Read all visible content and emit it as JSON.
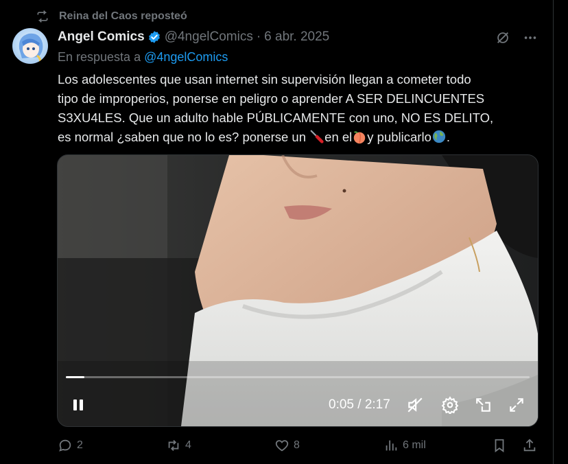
{
  "repost": {
    "text": "Reina del Caos reposteó",
    "icon": "repost-icon"
  },
  "author": {
    "name": "Angel Comics",
    "handle": "@4ngelComics",
    "separator": "·",
    "date": "6 abr. 2025",
    "verified": true
  },
  "reply_to": {
    "prefix": "En respuesta a",
    "handle": "@4ngelComics"
  },
  "tweet": {
    "line1": "Los adolescentes que usan internet sin supervisión llegan a cometer todo",
    "line2": "tipo de improperios, ponerse en peligro o aprender A SER DELINCUENTES",
    "line3": "S3XU4LES. Que un adulto hable PÚBLICAMENTE con uno, NO ES DELITO,",
    "line4_a": "es normal ¿saben que no lo es? ponerse un ",
    "line4_b": "en el",
    "line4_c": "y publicarlo",
    "line4_d": "."
  },
  "video": {
    "time": "0:05 / 2:17",
    "progress": 0.04,
    "muted": true
  },
  "actions": {
    "replies": "2",
    "reposts": "4",
    "likes": "8",
    "views": "6 mil"
  },
  "colors": {
    "background": "#000000",
    "text": "#e7e9ea",
    "muted": "#71767b",
    "link": "#1d9bf0",
    "verified": "#1d9bf0"
  }
}
